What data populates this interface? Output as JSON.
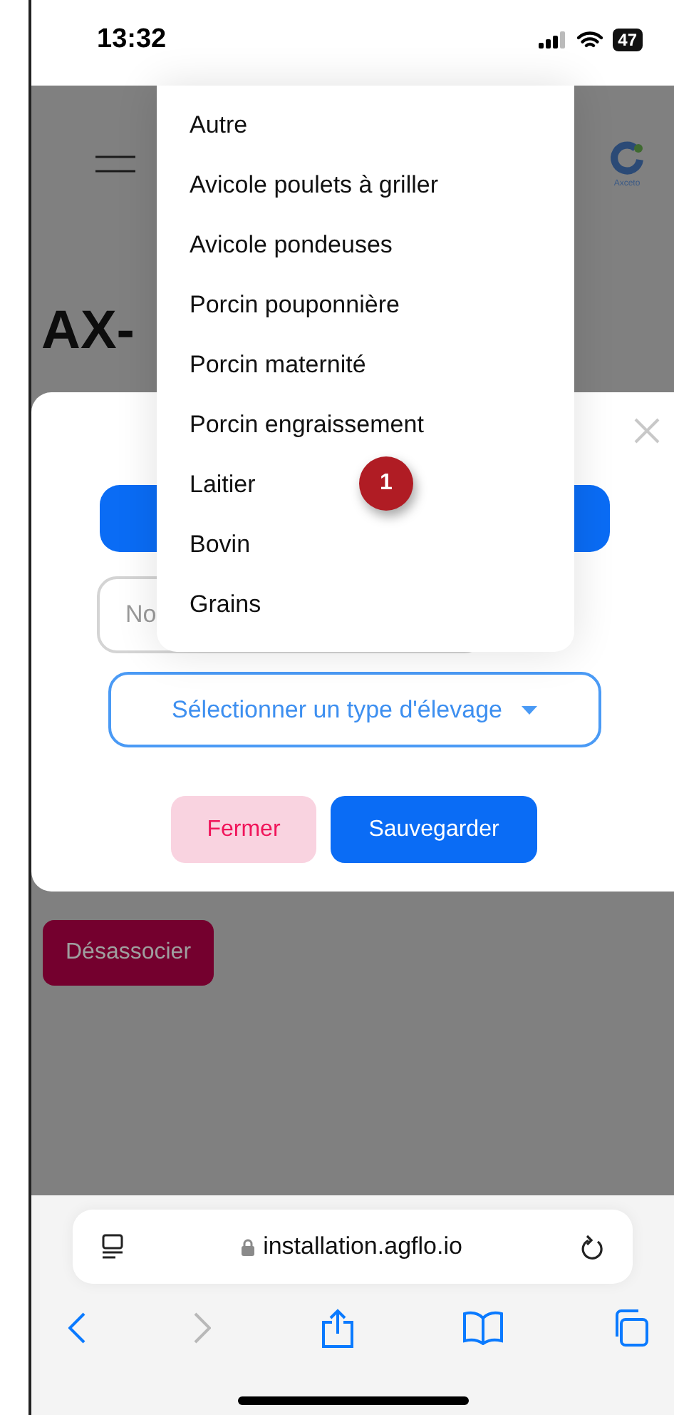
{
  "status_bar": {
    "time": "13:32",
    "battery": "47"
  },
  "page": {
    "title": "AX-",
    "logo_text": "Axceto",
    "unlink_button": "Désassocier"
  },
  "modal": {
    "name_field": {
      "placeholder": "No"
    },
    "select": {
      "label": "Sélectionner un type d'élevage"
    },
    "actions": [
      {
        "label": "Fermer",
        "kind": "secondary"
      },
      {
        "label": "Sauvegarder",
        "kind": "primary"
      }
    ]
  },
  "dropdown": {
    "items": [
      "Autre",
      "Avicole poulets à griller",
      "Avicole pondeuses",
      "Porcin pouponnière",
      "Porcin maternité",
      "Porcin engraissement",
      "Laitier",
      "Bovin",
      "Grains"
    ]
  },
  "annotation": {
    "label": "1"
  },
  "browser": {
    "url": "installation.agflo.io",
    "toolbar": [
      {
        "kind": "back",
        "disabled": false
      },
      {
        "kind": "forward",
        "disabled": true
      },
      {
        "kind": "share",
        "disabled": false
      },
      {
        "kind": "bookmarks",
        "disabled": false
      },
      {
        "kind": "tabs",
        "disabled": false
      }
    ]
  }
}
